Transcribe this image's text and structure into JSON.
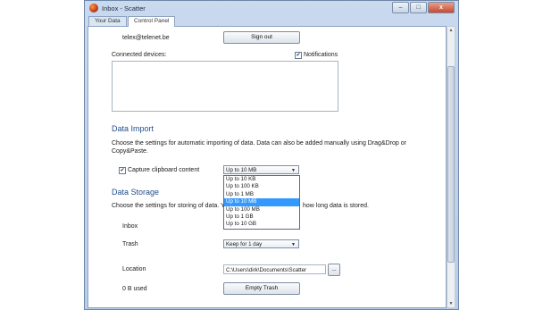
{
  "window": {
    "title": "Inbox - Scatter",
    "min": "–",
    "max": "□",
    "close": "x"
  },
  "tabs": [
    {
      "label": "Your Data"
    },
    {
      "label": "Control Panel"
    }
  ],
  "account": {
    "email": "telex@telenet.be",
    "sign_out_label": "Sign out"
  },
  "devices": {
    "label": "Connected devices:",
    "notifications_label": "Notifications",
    "notifications_checked": true
  },
  "data_import": {
    "heading": "Data Import",
    "description": "Choose the settings for automatic importing of data. Data can also be added manually using Drag&Drop or Copy&Paste.",
    "capture_label": "Capture clipboard content",
    "capture_checked": true,
    "selected": "Up to 10 MB",
    "options": [
      "Up to 10 KB",
      "Up to 100 KB",
      "Up to 1 MB",
      "Up to 10 MB",
      "Up to 100 MB",
      "Up to 1 GB",
      "Up to 10 GB"
    ],
    "highlighted_index": 3
  },
  "data_storage": {
    "heading": "Data Storage",
    "description_left": "Choose the settings for storing of data. Y",
    "description_right": "how long data is stored.",
    "inbox_label": "Inbox",
    "trash_label": "Trash",
    "trash_value": "Keep for 1 day",
    "location_label": "Location",
    "location_value": "C:\\Users\\dirk\\Documents\\Scatter",
    "browse_label": "...",
    "used_label": "0 B used",
    "empty_trash_label": "Empty Trash"
  },
  "colors": {
    "accent": "#1f4e8c",
    "highlight": "#3399ff"
  }
}
